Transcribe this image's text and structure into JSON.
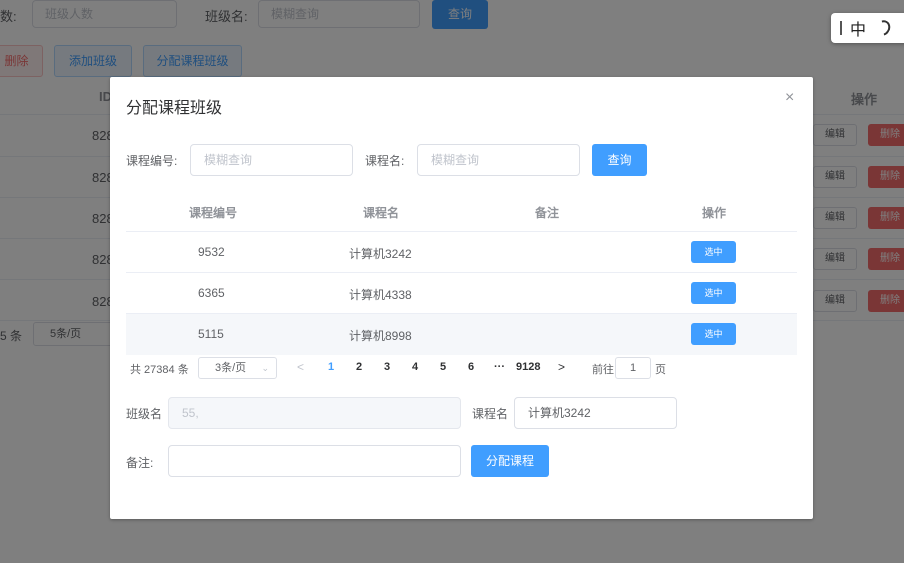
{
  "background": {
    "search": {
      "label1": "数:",
      "placeholder1": "班级人数",
      "label2": "班级名:",
      "placeholder2": "模糊查询",
      "query_label": "查询"
    },
    "toolbar": {
      "delete_label": "删除",
      "add_label": "添加班级",
      "assign_label": "分配课程班级"
    },
    "table": {
      "id_header": "ID",
      "op_header": "操作",
      "ids": [
        "828",
        "828",
        "828",
        "828",
        "828"
      ],
      "edit_label": "编辑",
      "delete_label": "删除"
    },
    "pager": {
      "total": "5 条",
      "page_size": "5条/页"
    }
  },
  "ime": {
    "lang": "中"
  },
  "dialog": {
    "title": "分配课程班级",
    "close": "×",
    "search": {
      "course_no_label": "课程编号:",
      "course_no_placeholder": "模糊查询",
      "course_name_label": "课程名:",
      "course_name_placeholder": "模糊查询",
      "query_label": "查询"
    },
    "table": {
      "headers": [
        "课程编号",
        "课程名",
        "备注",
        "操作"
      ],
      "rows": [
        {
          "no": "9532",
          "name": "计算机3242",
          "note": "",
          "action": "选中"
        },
        {
          "no": "6365",
          "name": "计算机4338",
          "note": "",
          "action": "选中"
        },
        {
          "no": "5115",
          "name": "计算机8998",
          "note": "",
          "action": "选中"
        }
      ]
    },
    "pager": {
      "total": "共 27384 条",
      "page_size": "3条/页",
      "prev": "<",
      "pages": [
        "1",
        "2",
        "3",
        "4",
        "5",
        "6",
        "···",
        "9128"
      ],
      "current": "1",
      "next": ">",
      "goto_label": "前往",
      "goto_value": "1",
      "page_suffix": "页"
    },
    "form": {
      "class_name_label": "班级名",
      "class_name_value": "55,",
      "course_name_label": "课程名",
      "course_name_value": "计算机3242",
      "note_label": "备注:",
      "note_value": "",
      "submit_label": "分配课程"
    }
  },
  "colors": {
    "primary": "#409eff",
    "danger": "#f56c6c",
    "overlay": "rgba(0,0,0,0.5)"
  }
}
